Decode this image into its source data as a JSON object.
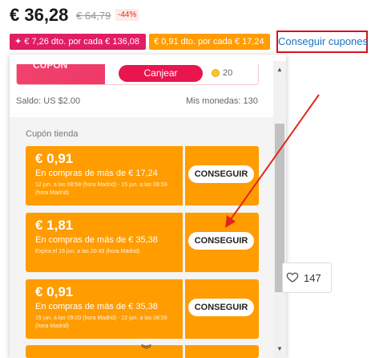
{
  "price": {
    "current": "€ 36,28",
    "original": "€ 64,79",
    "discount": "-44%"
  },
  "promos": {
    "store_discount": "✦ € 7,26 dto. por cada € 136,08",
    "seller_discount": "€ 0,91 dto. por cada € 17,24",
    "get_coupons": "Conseguir cupones"
  },
  "panel": {
    "top_card_label": "CUPÓN",
    "redeem_button": "Canjear",
    "coin_amount": "20",
    "balance": "Saldo: US $2.00",
    "my_coins": "Mis monedas: 130",
    "section_title": "Cupón tienda",
    "coupons": [
      {
        "amount": "€ 0,91",
        "condition": "En compras de más de € 17,24",
        "dates": "12 jun. a las 08:58 (hora Madrid) - 15 jun. a las 08:59 (hora Madrid)",
        "button": "CONSEGUIR"
      },
      {
        "amount": "€ 1,81",
        "condition": "En compras de más de € 35,38",
        "dates": "Expira el 16 jun. a las 20:43 (hora Madrid)",
        "button": "CONSEGUIR"
      },
      {
        "amount": "€ 0,91",
        "condition": "En compras de más de € 35,38",
        "dates": "15 jun. a las 09:00 (hora Madrid) - 22 jun. a las 08:59 (hora Madrid)",
        "button": "CONSEGUIR"
      }
    ]
  },
  "wishlist": {
    "count": "147"
  },
  "icons": {
    "heart": "heart-icon",
    "coin": "coin-icon",
    "expand": "chevron-down-double-icon"
  },
  "colors": {
    "coupon_orange": "#ff9c00",
    "accent_red": "#e8154e",
    "highlight_border": "#d4141f",
    "link_blue": "#1a73c2"
  }
}
